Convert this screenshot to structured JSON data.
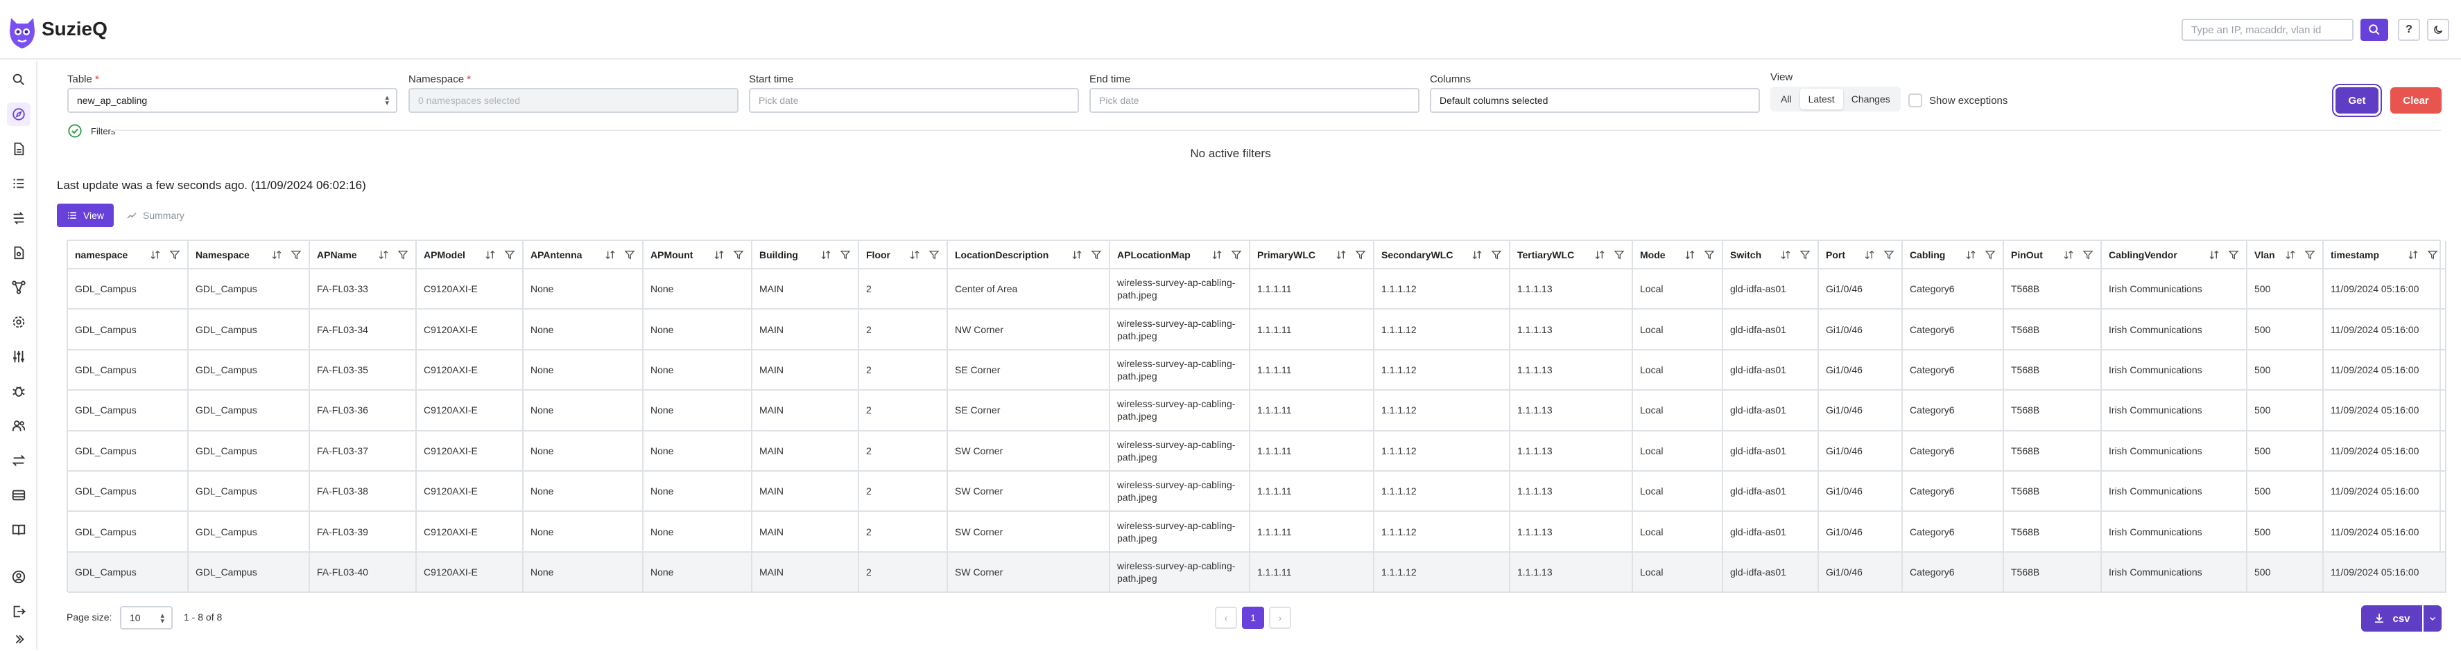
{
  "app": {
    "title": "SuzieQ"
  },
  "search": {
    "placeholder": "Type an IP, macaddr, vlan id"
  },
  "header": {
    "help_label": "?"
  },
  "form": {
    "table_label": "Table",
    "table_value": "new_ap_cabling",
    "namespace_label": "Namespace",
    "namespace_placeholder": "0 namespaces selected",
    "start_label": "Start time",
    "start_placeholder": "Pick date",
    "end_label": "End time",
    "end_placeholder": "Pick date",
    "columns_label": "Columns",
    "columns_value": "Default columns selected",
    "view_label": "View",
    "view_options": [
      "All",
      "Latest",
      "Changes"
    ],
    "view_selected": "Latest",
    "show_exceptions_label": "Show exceptions",
    "get_label": "Get",
    "clear_label": "Clear",
    "required_mark": "*"
  },
  "filters": {
    "label": "Filters",
    "empty_text": "No active filters"
  },
  "status": {
    "last_update": "Last update was a few seconds ago. (11/09/2024 06:02:16)"
  },
  "tabs": {
    "view_label": "View",
    "summary_label": "Summary"
  },
  "table": {
    "columns": [
      "namespace",
      "Namespace",
      "APName",
      "APModel",
      "APAntenna",
      "APMount",
      "Building",
      "Floor",
      "LocationDescription",
      "APLocationMap",
      "PrimaryWLC",
      "SecondaryWLC",
      "TertiaryWLC",
      "Mode",
      "Switch",
      "Port",
      "Cabling",
      "PinOut",
      "CablingVendor",
      "Vlan",
      "timestamp"
    ],
    "rows": [
      [
        "GDL_Campus",
        "GDL_Campus",
        "FA-FL03-33",
        "C9120AXI-E",
        "None",
        "None",
        "MAIN",
        "2",
        "Center of Area",
        "wireless-survey-ap-cabling-path.jpeg",
        "1.1.1.11",
        "1.1.1.12",
        "1.1.1.13",
        "Local",
        "gld-idfa-as01",
        "Gi1/0/46",
        "Category6",
        "T568B",
        "Irish Communications",
        "500",
        "11/09/2024 05:16:00"
      ],
      [
        "GDL_Campus",
        "GDL_Campus",
        "FA-FL03-34",
        "C9120AXI-E",
        "None",
        "None",
        "MAIN",
        "2",
        "NW Corner",
        "wireless-survey-ap-cabling-path.jpeg",
        "1.1.1.11",
        "1.1.1.12",
        "1.1.1.13",
        "Local",
        "gld-idfa-as01",
        "Gi1/0/46",
        "Category6",
        "T568B",
        "Irish Communications",
        "500",
        "11/09/2024 05:16:00"
      ],
      [
        "GDL_Campus",
        "GDL_Campus",
        "FA-FL03-35",
        "C9120AXI-E",
        "None",
        "None",
        "MAIN",
        "2",
        "SE Corner",
        "wireless-survey-ap-cabling-path.jpeg",
        "1.1.1.11",
        "1.1.1.12",
        "1.1.1.13",
        "Local",
        "gld-idfa-as01",
        "Gi1/0/46",
        "Category6",
        "T568B",
        "Irish Communications",
        "500",
        "11/09/2024 05:16:00"
      ],
      [
        "GDL_Campus",
        "GDL_Campus",
        "FA-FL03-36",
        "C9120AXI-E",
        "None",
        "None",
        "MAIN",
        "2",
        "SE Corner",
        "wireless-survey-ap-cabling-path.jpeg",
        "1.1.1.11",
        "1.1.1.12",
        "1.1.1.13",
        "Local",
        "gld-idfa-as01",
        "Gi1/0/46",
        "Category6",
        "T568B",
        "Irish Communications",
        "500",
        "11/09/2024 05:16:00"
      ],
      [
        "GDL_Campus",
        "GDL_Campus",
        "FA-FL03-37",
        "C9120AXI-E",
        "None",
        "None",
        "MAIN",
        "2",
        "SW Corner",
        "wireless-survey-ap-cabling-path.jpeg",
        "1.1.1.11",
        "1.1.1.12",
        "1.1.1.13",
        "Local",
        "gld-idfa-as01",
        "Gi1/0/46",
        "Category6",
        "T568B",
        "Irish Communications",
        "500",
        "11/09/2024 05:16:00"
      ],
      [
        "GDL_Campus",
        "GDL_Campus",
        "FA-FL03-38",
        "C9120AXI-E",
        "None",
        "None",
        "MAIN",
        "2",
        "SW Corner",
        "wireless-survey-ap-cabling-path.jpeg",
        "1.1.1.11",
        "1.1.1.12",
        "1.1.1.13",
        "Local",
        "gld-idfa-as01",
        "Gi1/0/46",
        "Category6",
        "T568B",
        "Irish Communications",
        "500",
        "11/09/2024 05:16:00"
      ],
      [
        "GDL_Campus",
        "GDL_Campus",
        "FA-FL03-39",
        "C9120AXI-E",
        "None",
        "None",
        "MAIN",
        "2",
        "SW Corner",
        "wireless-survey-ap-cabling-path.jpeg",
        "1.1.1.11",
        "1.1.1.12",
        "1.1.1.13",
        "Local",
        "gld-idfa-as01",
        "Gi1/0/46",
        "Category6",
        "T568B",
        "Irish Communications",
        "500",
        "11/09/2024 05:16:00"
      ],
      [
        "GDL_Campus",
        "GDL_Campus",
        "FA-FL03-40",
        "C9120AXI-E",
        "None",
        "None",
        "MAIN",
        "2",
        "SW Corner",
        "wireless-survey-ap-cabling-path.jpeg",
        "1.1.1.11",
        "1.1.1.12",
        "1.1.1.13",
        "Local",
        "gld-idfa-as01",
        "Gi1/0/46",
        "Category6",
        "T568B",
        "Irish Communications",
        "500",
        "11/09/2024 05:16:00"
      ]
    ]
  },
  "footer": {
    "page_size_label": "Page size:",
    "page_size_value": "10",
    "rows_info": "1 - 8 of 8",
    "prev_label": "‹",
    "current_page": "1",
    "next_label": "›",
    "csv_label": "csv"
  },
  "sidebar": {
    "icons": [
      "search-icon",
      "explore-icon",
      "document-icon",
      "list-icon",
      "route-icon",
      "report-icon",
      "network-icon",
      "settings-icon",
      "sliders-icon",
      "bug-icon",
      "users-icon",
      "transfer-icon",
      "table-icon",
      "book-icon",
      "account-icon",
      "logout-icon",
      "collapse-icon"
    ],
    "active": "explore-icon"
  },
  "colors": {
    "accent": "#6741d9",
    "danger": "#e8554e",
    "border": "#dee2e6"
  }
}
